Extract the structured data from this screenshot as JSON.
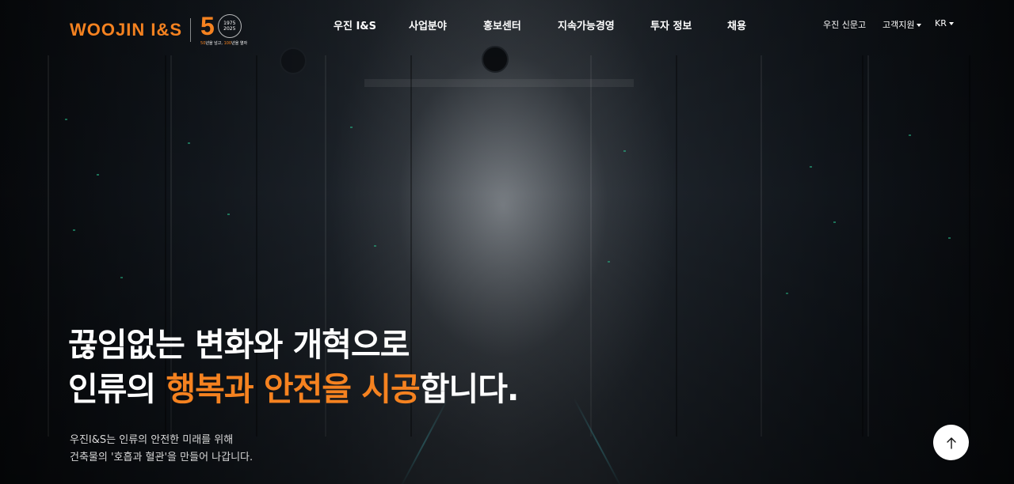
{
  "brand": {
    "logo_text": "WOOJIN I&S",
    "anniversary_number": "5",
    "seal_years": [
      "1975",
      "2025"
    ],
    "tagline_parts": [
      "50",
      "년을 넘고, ",
      "100",
      "년을 열자"
    ],
    "accent_color": "#f58220"
  },
  "nav": {
    "items": [
      {
        "label": "우진 I&S"
      },
      {
        "label": "사업분야"
      },
      {
        "label": "홍보센터"
      },
      {
        "label": "지속가능경영"
      },
      {
        "label": "투자 정보"
      },
      {
        "label": "채용"
      }
    ]
  },
  "utility": {
    "report": "우진 신문고",
    "support": "고객지원",
    "language": "KR"
  },
  "hero": {
    "line1": "끊임없는 변화와 개혁으로",
    "line2_pre": "인류의 ",
    "line2_accent": "행복과 안전을 시공",
    "line2_post": "합니다.",
    "sub_line1": "우진I&S는 인류의 안전한 미래를 위해",
    "sub_line2": "건축물의 '호흡과 혈관'을 만들어 나갑니다."
  },
  "icons": {
    "top_button": "arrow-up-icon",
    "dropdown": "caret-down-icon"
  }
}
